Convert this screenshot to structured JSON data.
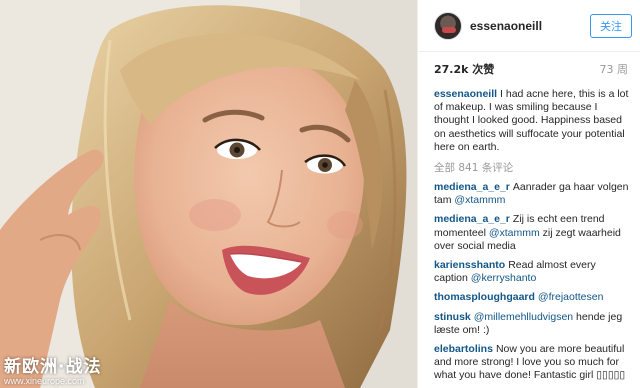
{
  "photo": {
    "alt_icon": "portrait-photo",
    "watermark_title": "新欧洲·战法",
    "watermark_url": "www.xineurope.com"
  },
  "header": {
    "username": "essenaoneill",
    "follow_label": "关注"
  },
  "stats": {
    "likes": "27.2k 次赞",
    "age": "73 周"
  },
  "caption": {
    "user": "essenaoneill",
    "text": "I had acne here, this is a lot of makeup. I was smiling because I thought I looked good. Happiness based on aesthetics will suffocate your potential here on earth."
  },
  "view_all_comments": "全部 841 条评论",
  "comments": [
    {
      "user": "mediena_a_e_r",
      "before": "Aanrader ga haar volgen tam ",
      "mention": "@xtammm",
      "after": ""
    },
    {
      "user": "mediena_a_e_r",
      "before": "Zij is echt een trend momenteel ",
      "mention": "@xtammm",
      "after": " zij zegt waarheid over social media"
    },
    {
      "user": "kariensshanto",
      "before": "Read almost every caption ",
      "mention": "@kerryshanto",
      "after": ""
    },
    {
      "user": "thomasploughgaard",
      "before": "",
      "mention": "@frejaottesen",
      "after": ""
    },
    {
      "user": "stinusk",
      "before": "",
      "mention": "@millemehlludvigsen",
      "after": " hende jeg læste om! :)"
    },
    {
      "user": "elebartolins",
      "before": "Now you are more beautiful and more strong! I love you so much for what you have done! Fantastic girl ▯▯▯▯▯",
      "mention": "",
      "after": ""
    }
  ],
  "colors": {
    "link": "#125688",
    "follow": "#3897f0",
    "muted": "#999999"
  }
}
